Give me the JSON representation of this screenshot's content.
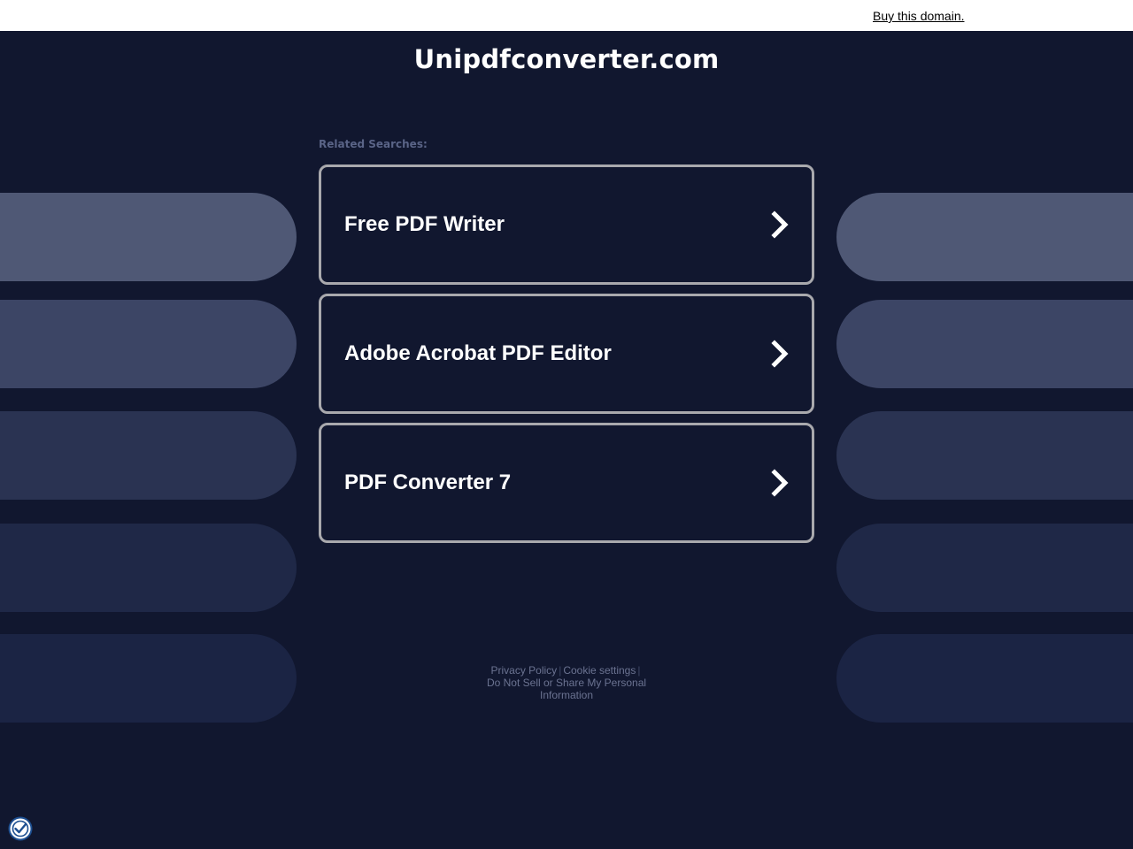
{
  "topbar": {
    "buy_label": "Buy this domain."
  },
  "site": {
    "title": "Unipdfconverter.com"
  },
  "related": {
    "label": "Related Searches:",
    "items": [
      {
        "label": "Free PDF Writer"
      },
      {
        "label": "Adobe Acrobat PDF Editor"
      },
      {
        "label": "PDF Converter 7"
      }
    ]
  },
  "footer": {
    "privacy": "Privacy Policy",
    "cookies": "Cookie settings",
    "do_not_sell": "Do Not Sell or Share My Personal Information"
  },
  "colors": {
    "background": "#11172f",
    "card_border": "#a9a9ad",
    "deco_row_1": "#4f5875",
    "deco_row_2": "#3c4565",
    "deco_row_3": "#2a3352",
    "deco_row_4": "#1f2847",
    "deco_row_5": "#1b2444"
  },
  "icons": {
    "chevron": "chevron-right-icon",
    "privacy": "privacy-shield-icon"
  }
}
